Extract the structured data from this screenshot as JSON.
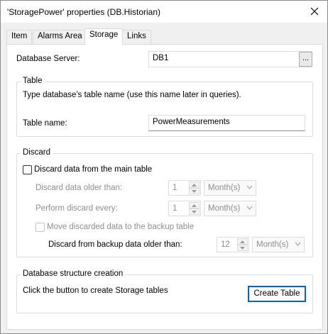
{
  "window": {
    "title": "'StoragePower' properties (DB.Historian)"
  },
  "tabs": [
    {
      "label": "Item"
    },
    {
      "label": "Alarms Area"
    },
    {
      "label": "Storage"
    },
    {
      "label": "Links"
    }
  ],
  "active_tab": "Storage",
  "database_server": {
    "label": "Database Server:",
    "value": "DB1",
    "browse_label": "..."
  },
  "table_group": {
    "title": "Table",
    "description": "Type database's table name (use this name later in queries).",
    "name_label": "Table name:",
    "name_value": "PowerMeasurements"
  },
  "discard_group": {
    "title": "Discard",
    "discard_checkbox_label": "Discard data from the main table",
    "older_than_label": "Discard data older than:",
    "older_than_value": "1",
    "older_than_unit": "Month(s)",
    "every_label": "Perform discard every:",
    "every_value": "1",
    "every_unit": "Month(s)",
    "move_checkbox_label": "Move discarded data to the backup table",
    "backup_older_label": "Discard from backup data older than:",
    "backup_older_value": "12",
    "backup_older_unit": "Month(s)"
  },
  "structure_group": {
    "title": "Database structure creation",
    "description": "Click the button to create Storage tables",
    "create_button_label": "Create Table"
  },
  "colors": {
    "accent": "#0067c0",
    "disabled_text": "#8d8d8d"
  }
}
